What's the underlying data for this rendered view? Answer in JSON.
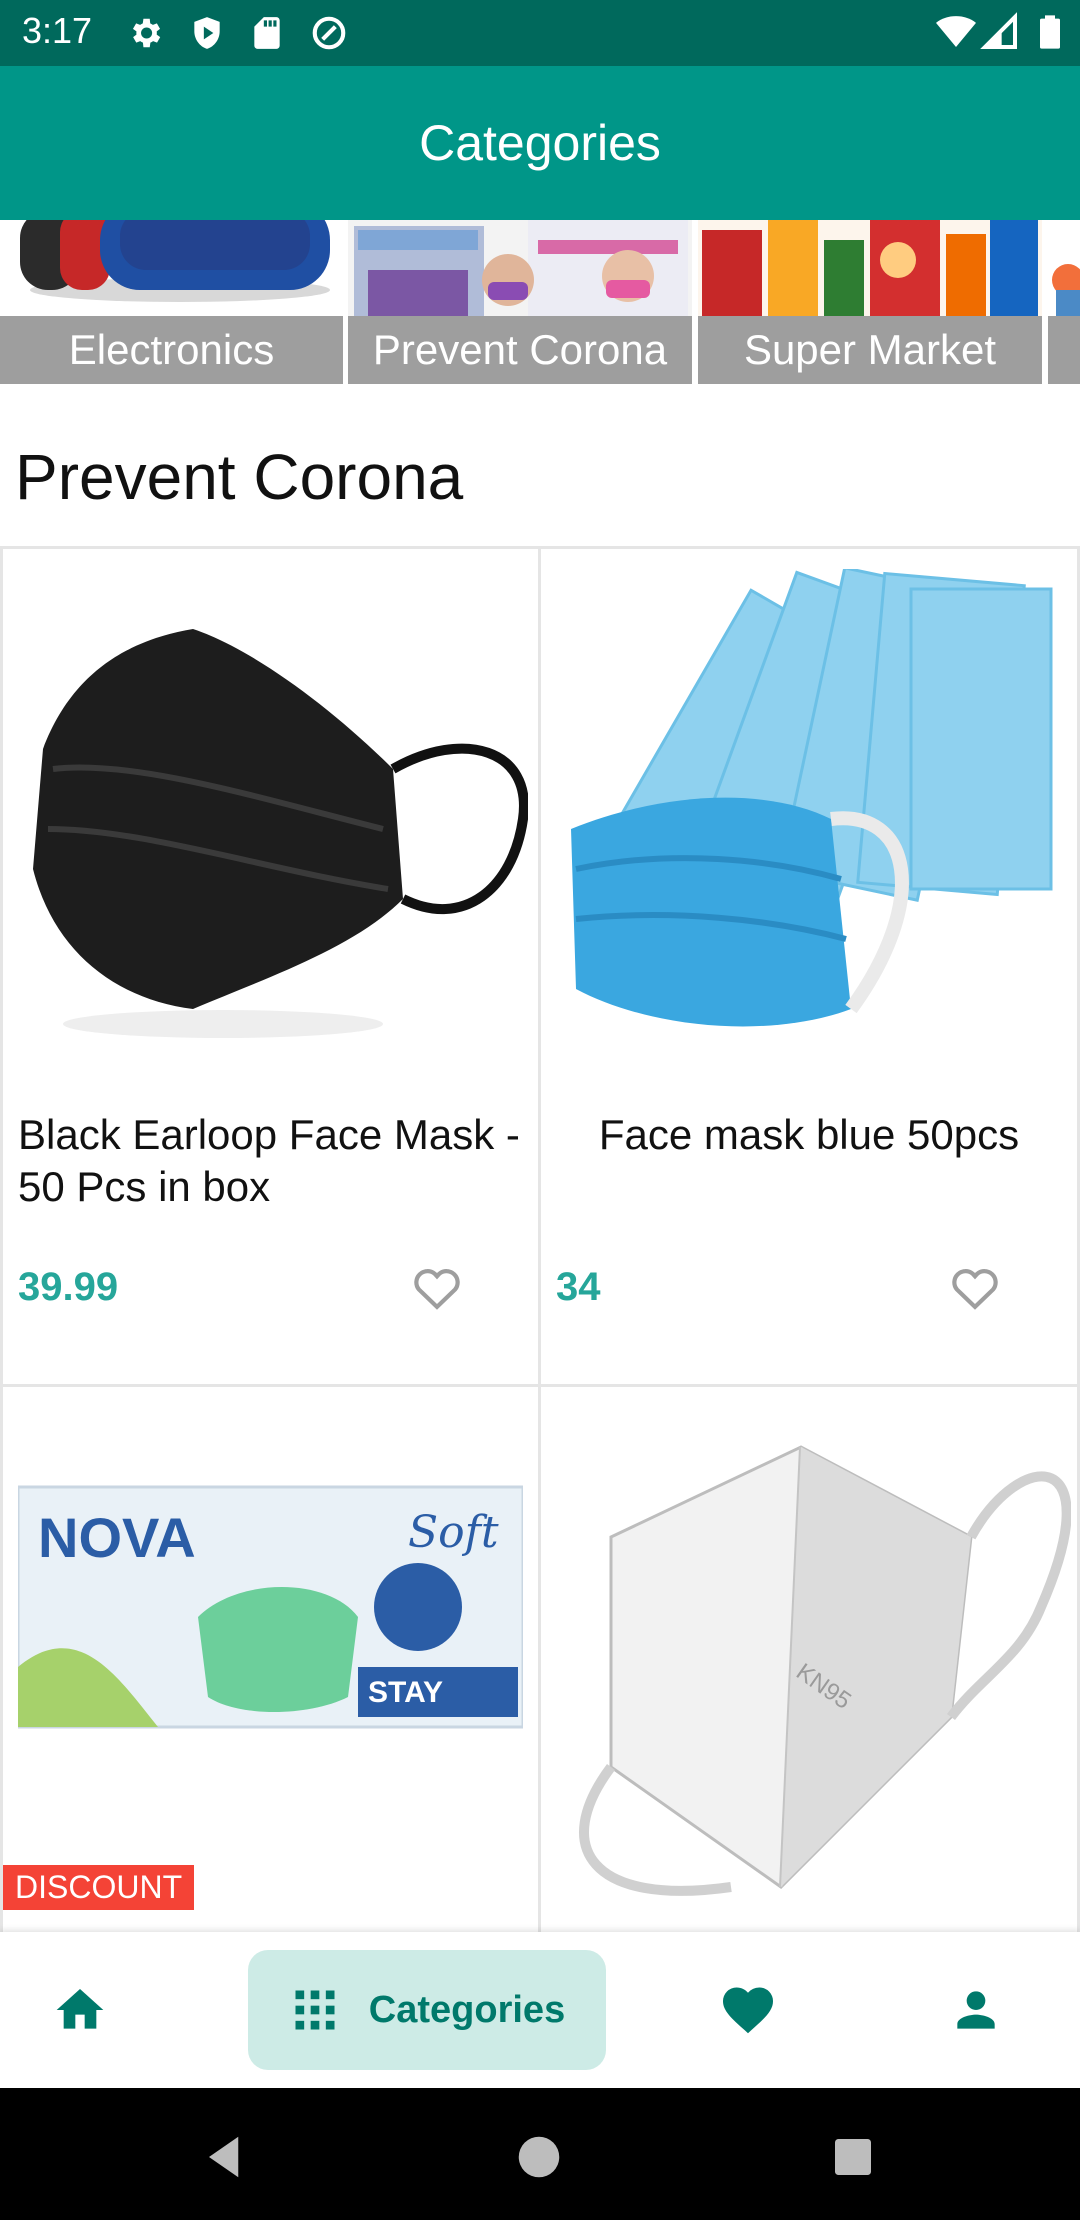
{
  "status_bar": {
    "time": "3:17",
    "icons": [
      "settings-icon",
      "shield-play-icon",
      "sd-card-icon",
      "at-sign-icon"
    ],
    "right_icons": [
      "wifi-icon",
      "signal-icon",
      "battery-icon"
    ]
  },
  "app_bar": {
    "title": "Categories"
  },
  "categories": [
    {
      "label": "Electronics",
      "image": "speaker-image"
    },
    {
      "label": "Prevent Corona",
      "image": "face-mask-boxes-image"
    },
    {
      "label": "Super Market",
      "image": "groceries-image"
    }
  ],
  "section": {
    "title": "Prevent Corona"
  },
  "products": [
    {
      "name": "Black Earloop Face Mask - 50 Pcs in box",
      "price": "39.99",
      "image": "black-mask-image",
      "favorite_icon": "heart-outline-icon"
    },
    {
      "name": "Face mask blue 50pcs",
      "price": "34",
      "image": "blue-mask-image",
      "favorite_icon": "heart-outline-icon"
    },
    {
      "name": "",
      "price": "",
      "image": "nova-mask-box-image",
      "badge": "DISCOUNT"
    },
    {
      "name": "",
      "price": "",
      "image": "kn95-mask-image"
    }
  ],
  "bottom_nav": {
    "items": [
      {
        "icon": "home-icon",
        "label": ""
      },
      {
        "icon": "grid-icon",
        "label": "Categories",
        "active": true
      },
      {
        "icon": "heart-icon",
        "label": ""
      },
      {
        "icon": "person-icon",
        "label": ""
      }
    ]
  },
  "system_nav": [
    "back-icon",
    "home-circle-icon",
    "recents-icon"
  ],
  "colors": {
    "status_bar": "#00695c",
    "app_bar": "#009688",
    "price": "#26a69a",
    "nav_active_bg": "#cdebe6",
    "nav_icon": "#00796b",
    "discount": "#f44336"
  }
}
